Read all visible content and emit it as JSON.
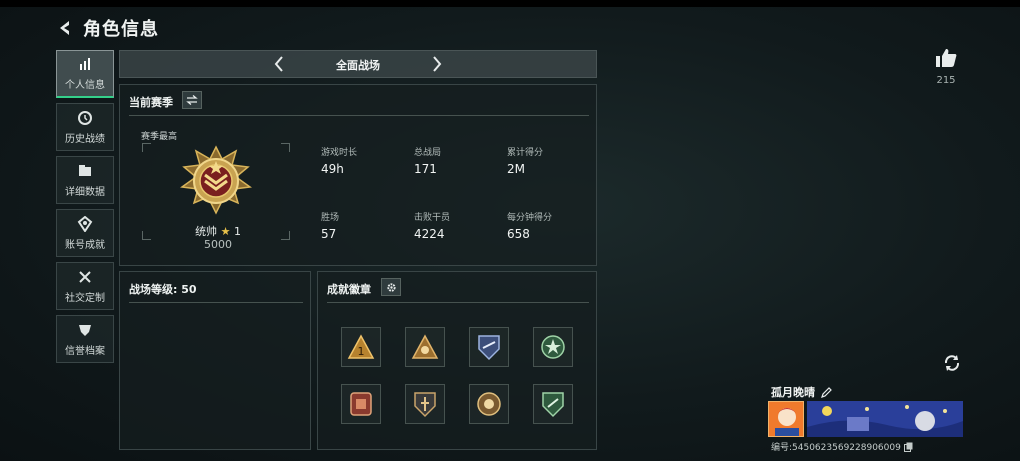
{
  "header": {
    "title": "角色信息"
  },
  "sidebar": {
    "items": [
      {
        "label": "个人信息",
        "icon": "bar-chart-icon",
        "active": true
      },
      {
        "label": "历史战绩",
        "icon": "clock-icon"
      },
      {
        "label": "详细数据",
        "icon": "folder-icon"
      },
      {
        "label": "账号成就",
        "icon": "medal-icon"
      },
      {
        "label": "社交定制",
        "icon": "tools-icon"
      },
      {
        "label": "信誉档案",
        "icon": "shield-icon"
      }
    ]
  },
  "mode": {
    "label": "全面战场"
  },
  "season": {
    "title": "当前赛季",
    "best_label": "赛季最高",
    "rank_name": "统帅",
    "rank_star": "★",
    "rank_level": "1",
    "rank_score": "5000",
    "stats": [
      {
        "label": "游戏时长",
        "value": "49h"
      },
      {
        "label": "总战局",
        "value": "171"
      },
      {
        "label": "累计得分",
        "value": "2M"
      },
      {
        "label": "胜场",
        "value": "57"
      },
      {
        "label": "击败干员",
        "value": "4224"
      },
      {
        "label": "每分钟得分",
        "value": "658"
      }
    ]
  },
  "battle_level": {
    "label": "战场等级: 50"
  },
  "achievements": {
    "title": "成就徽章"
  },
  "likes": {
    "count": "215"
  },
  "profile": {
    "name": "孤月晚晴",
    "id_text": "编号:5450623569228906009"
  },
  "colors": {
    "accent": "#34d08a",
    "gold": "#d8b45a"
  }
}
